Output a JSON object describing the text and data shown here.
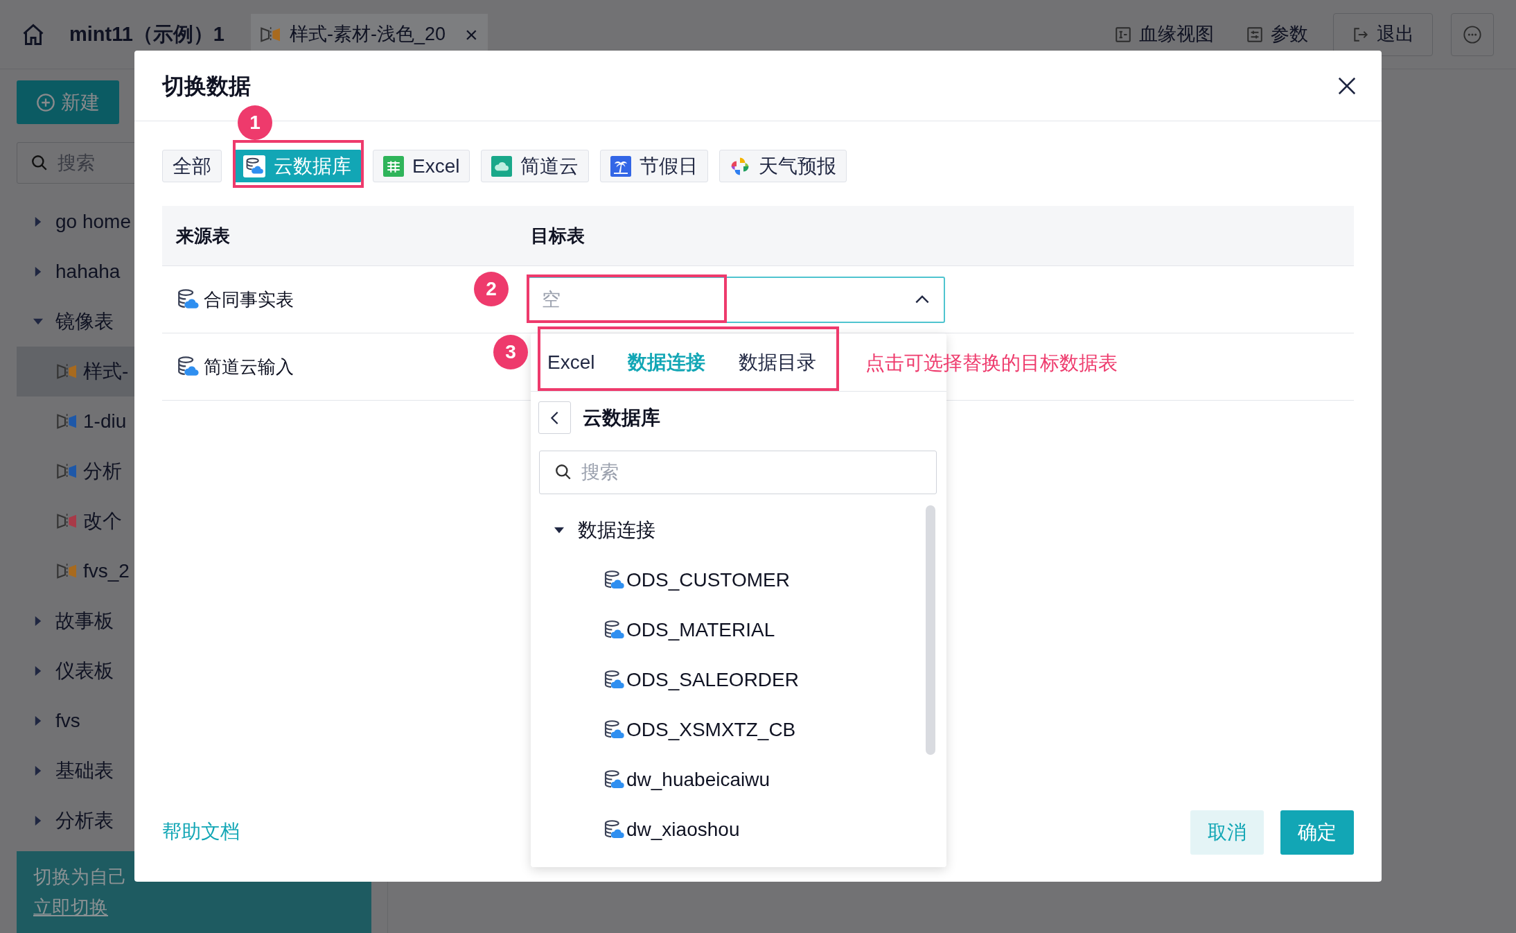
{
  "top_bar": {
    "project_title": "mint11（示例）1",
    "tabs": [
      {
        "label": "样式-素材-浅色_20",
        "selected": true,
        "close": "×"
      }
    ],
    "actions": [
      {
        "label": "血缘视图",
        "kind": "lineage"
      },
      {
        "label": "参数",
        "kind": "params"
      },
      {
        "label": "退出",
        "kind": "exit"
      }
    ]
  },
  "sidebar": {
    "new_button": "新建",
    "search": {
      "placeholder": "搜索"
    },
    "tree": [
      {
        "label": "go home",
        "expanded": false
      },
      {
        "label": "hahaha",
        "expanded": false
      },
      {
        "label": "镜像表",
        "expanded": true,
        "children": [
          {
            "label": "样式-",
            "color": "#a86a1e",
            "selected": true
          },
          {
            "label": "1-diu",
            "color": "#1e58a8",
            "selected": false
          },
          {
            "label": "分析",
            "color": "#1e58a8",
            "selected": false
          },
          {
            "label": "改个",
            "color": "#a83a48",
            "selected": false
          },
          {
            "label": "fvs_2",
            "color": "#a86a1e",
            "selected": false
          }
        ]
      },
      {
        "label": "故事板",
        "expanded": false
      },
      {
        "label": "仪表板",
        "expanded": false
      },
      {
        "label": "fvs",
        "expanded": false
      },
      {
        "label": "基础表",
        "expanded": false
      },
      {
        "label": "分析表",
        "expanded": false
      }
    ],
    "banner": {
      "text": "切换为自己",
      "link": "立即切换"
    }
  },
  "dialog": {
    "title": "切换数据",
    "source_tabs": [
      {
        "label": "全部",
        "selected": false,
        "kind": "all"
      },
      {
        "label": "云数据库",
        "selected": true,
        "kind": "cloud_db"
      },
      {
        "label": "Excel",
        "selected": false,
        "kind": "excel"
      },
      {
        "label": "简道云",
        "selected": false,
        "kind": "jdy"
      },
      {
        "label": "节假日",
        "selected": false,
        "kind": "holiday"
      },
      {
        "label": "天气预报",
        "selected": false,
        "kind": "weather"
      }
    ],
    "table": {
      "columns": [
        "来源表",
        "目标表"
      ],
      "rows": [
        {
          "source": "合同事实表"
        },
        {
          "source": "简道云输入"
        }
      ]
    },
    "target_select": {
      "placeholder": "空",
      "expanded": true
    },
    "dropdown": {
      "tabs": [
        {
          "label": "Excel",
          "selected": false
        },
        {
          "label": "数据连接",
          "selected": true
        },
        {
          "label": "数据目录",
          "selected": false
        }
      ],
      "back_title": "云数据库",
      "search": {
        "placeholder": "搜索"
      },
      "tree": [
        {
          "label": "数据连接",
          "expanded": true,
          "children": [
            {
              "label": "ODS_CUSTOMER"
            },
            {
              "label": "ODS_MATERIAL"
            },
            {
              "label": "ODS_SALEORDER"
            },
            {
              "label": "ODS_XSMXTZ_CB"
            },
            {
              "label": "dw_huabeicaiwu"
            },
            {
              "label": "dw_xiaoshou"
            }
          ]
        }
      ]
    },
    "help_link": "帮助文档",
    "buttons": [
      {
        "label": "取消",
        "kind": "secondary"
      },
      {
        "label": "确定",
        "kind": "primary"
      }
    ]
  },
  "annotations": {
    "badges": [
      "1",
      "2",
      "3"
    ],
    "note": "点击可选择替换的目标数据表"
  }
}
